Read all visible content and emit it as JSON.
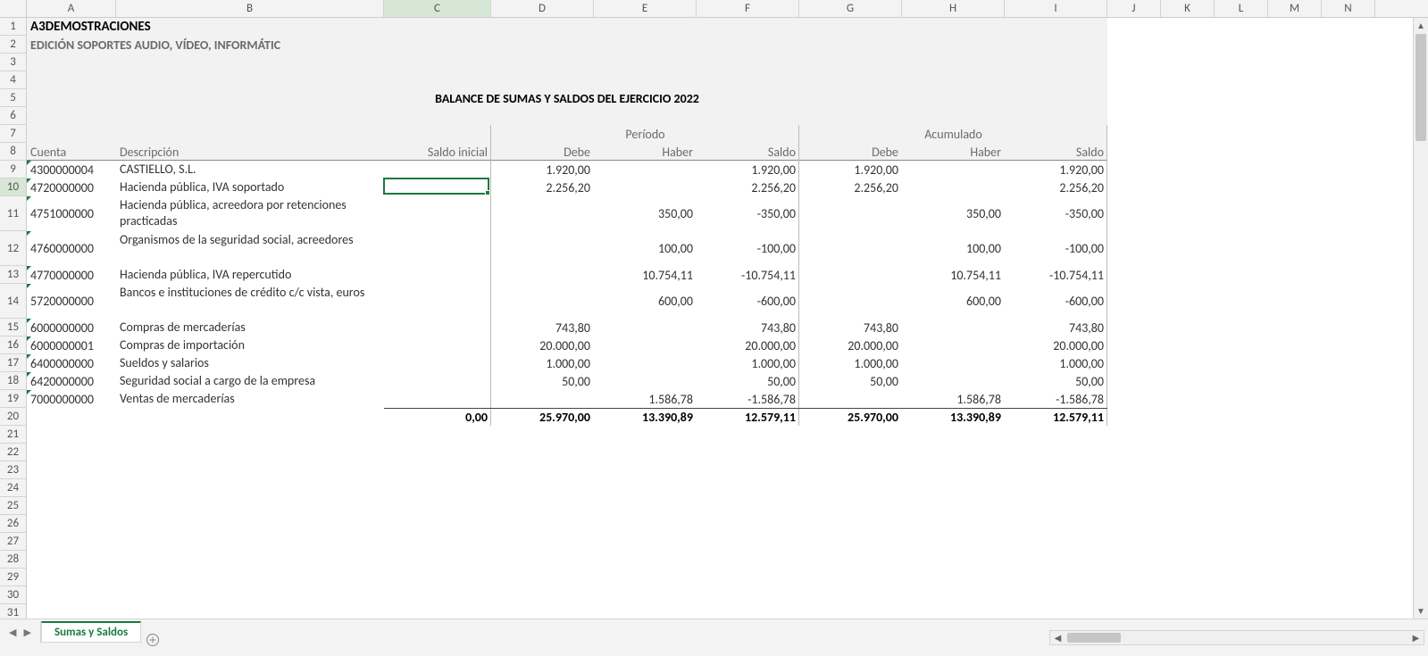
{
  "columns": {
    "letters": [
      "A",
      "B",
      "C",
      "D",
      "E",
      "F",
      "G",
      "H",
      "I",
      "J",
      "K",
      "L",
      "M",
      "N"
    ],
    "widths": [
      100,
      300,
      120,
      115,
      115,
      115,
      115,
      115,
      115,
      60,
      60,
      60,
      60,
      60
    ]
  },
  "row_heights": {
    "default": 20,
    "tall": 39
  },
  "visible_rows": 33,
  "company": "A3DEMOSTRACIONES",
  "subtitle": "EDICIÓN SOPORTES AUDIO, VÍDEO, INFORMÁTIC",
  "report_title": "BALANCE DE SUMAS Y SALDOS DEL EJERCICIO 2022",
  "group_period": "Período",
  "group_accum": "Acumulado",
  "headers": {
    "cuenta": "Cuenta",
    "descripcion": "Descripción",
    "saldo_inicial": "Saldo inicial",
    "debe": "Debe",
    "haber": "Haber",
    "saldo": "Saldo"
  },
  "rows": [
    {
      "cuenta": "4300000004",
      "desc": "CASTIELLO, S.L.",
      "si": "",
      "pd": "1.920,00",
      "ph": "",
      "ps": "1.920,00",
      "ad": "1.920,00",
      "ah": "",
      "as": "1.920,00"
    },
    {
      "cuenta": "4720000000",
      "desc": "Hacienda pública, IVA soportado",
      "si": "",
      "pd": "2.256,20",
      "ph": "",
      "ps": "2.256,20",
      "ad": "2.256,20",
      "ah": "",
      "as": "2.256,20"
    },
    {
      "cuenta": "4751000000",
      "desc": "Hacienda pública, acreedora por retenciones practicadas",
      "si": "",
      "pd": "",
      "ph": "350,00",
      "ps": "-350,00",
      "ad": "",
      "ah": "350,00",
      "as": "-350,00",
      "tall": true
    },
    {
      "cuenta": "4760000000",
      "desc": "Organismos de la seguridad social, acreedores",
      "si": "",
      "pd": "",
      "ph": "100,00",
      "ps": "-100,00",
      "ad": "",
      "ah": "100,00",
      "as": "-100,00",
      "tall": true
    },
    {
      "cuenta": "4770000000",
      "desc": "Hacienda pública, IVA repercutido",
      "si": "",
      "pd": "",
      "ph": "10.754,11",
      "ps": "-10.754,11",
      "ad": "",
      "ah": "10.754,11",
      "as": "-10.754,11"
    },
    {
      "cuenta": "5720000000",
      "desc": "Bancos e instituciones de crédito c/c vista, euros",
      "si": "",
      "pd": "",
      "ph": "600,00",
      "ps": "-600,00",
      "ad": "",
      "ah": "600,00",
      "as": "-600,00",
      "tall": true
    },
    {
      "cuenta": "6000000000",
      "desc": "Compras de mercaderías",
      "si": "",
      "pd": "743,80",
      "ph": "",
      "ps": "743,80",
      "ad": "743,80",
      "ah": "",
      "as": "743,80"
    },
    {
      "cuenta": "6000000001",
      "desc": "Compras de importación",
      "si": "",
      "pd": "20.000,00",
      "ph": "",
      "ps": "20.000,00",
      "ad": "20.000,00",
      "ah": "",
      "as": "20.000,00"
    },
    {
      "cuenta": "6400000000",
      "desc": "Sueldos y salarios",
      "si": "",
      "pd": "1.000,00",
      "ph": "",
      "ps": "1.000,00",
      "ad": "1.000,00",
      "ah": "",
      "as": "1.000,00"
    },
    {
      "cuenta": "6420000000",
      "desc": "Seguridad social a cargo de la empresa",
      "si": "",
      "pd": "50,00",
      "ph": "",
      "ps": "50,00",
      "ad": "50,00",
      "ah": "",
      "as": "50,00"
    },
    {
      "cuenta": "7000000000",
      "desc": "Ventas de mercaderías",
      "si": "",
      "pd": "",
      "ph": "1.586,78",
      "ps": "-1.586,78",
      "ad": "",
      "ah": "1.586,78",
      "as": "-1.586,78"
    }
  ],
  "totals": {
    "si": "0,00",
    "pd": "25.970,00",
    "ph": "13.390,89",
    "ps": "12.579,11",
    "ad": "25.970,00",
    "ah": "13.390,89",
    "as": "12.579,11"
  },
  "tab_name": "Sumas y Saldos",
  "active_cell": {
    "col": "C",
    "row": 10
  }
}
